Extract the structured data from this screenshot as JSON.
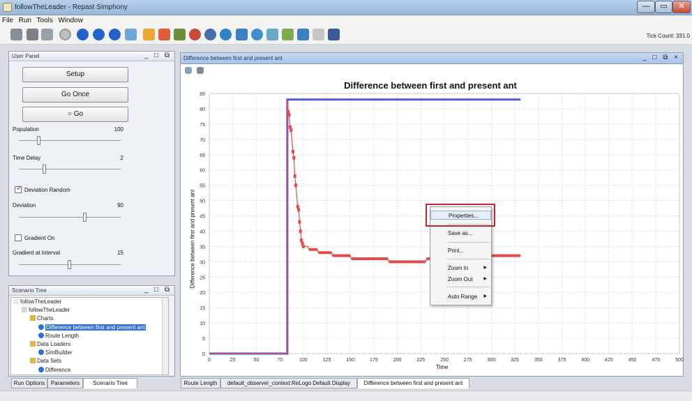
{
  "window": {
    "title": "followTheLeader - Repast Simphony",
    "controls": {
      "minimize": "—",
      "maximize": "▭",
      "close": "✕"
    }
  },
  "menu": [
    "File",
    "Run",
    "Tools",
    "Window"
  ],
  "toolbar": {
    "icons": [
      "save-icon",
      "disk-icon",
      "database-icon",
      "power-icon",
      "play-icon",
      "step-icon",
      "stop-icon",
      "reset-icon",
      "dock-icon",
      "line-chart-icon",
      "histogram-icon",
      "agents-icon",
      "gis-icon",
      "data-icon",
      "network-icon",
      "console-icon",
      "globe-icon",
      "users-icon",
      "image-icon",
      "grid-icon",
      "table-icon",
      "truck-icon"
    ],
    "tick_count": "Tick Count: 331.0"
  },
  "user_panel": {
    "title": "User Panel",
    "controls": "_ □ ⧉",
    "setup": "Setup",
    "go_once": "Go Once",
    "go": "○ Go",
    "population": {
      "label": "Population",
      "value": "100",
      "fraction": 0.2
    },
    "time_delay": {
      "label": "Time Delay",
      "value": "2",
      "fraction": 0.25
    },
    "deviation_random": {
      "label": "Deviation Random",
      "checked": true
    },
    "deviation": {
      "label": "Deviation",
      "value": "90",
      "fraction": 0.65
    },
    "gradient_on": {
      "label": "Gradient On",
      "checked": false
    },
    "gradient_interval": {
      "label": "Gradient at Interval",
      "value": "15",
      "fraction": 0.5
    }
  },
  "scenario_tree": {
    "title": "Scenario Tree",
    "controls": "_ □ ⧉",
    "nodes": [
      {
        "label": "followTheLeader",
        "icon": "project-icon",
        "depth": 0,
        "selected": false
      },
      {
        "label": "followTheLeader",
        "icon": "model-icon",
        "depth": 1,
        "selected": false
      },
      {
        "label": "Charts",
        "icon": "folder-icon",
        "depth": 2,
        "selected": false
      },
      {
        "label": "Difference between first and present ant",
        "icon": "chart-node-icon",
        "depth": 3,
        "selected": true
      },
      {
        "label": "Route Length",
        "icon": "chart-node-icon",
        "depth": 3,
        "selected": false
      },
      {
        "label": "Data Loaders",
        "icon": "folder-icon",
        "depth": 2,
        "selected": false
      },
      {
        "label": "SimBuilder",
        "icon": "loader-node-icon",
        "depth": 3,
        "selected": false
      },
      {
        "label": "Data Sets",
        "icon": "folder-icon",
        "depth": 2,
        "selected": false
      },
      {
        "label": "Difference",
        "icon": "dataset-node-icon",
        "depth": 3,
        "selected": false
      }
    ]
  },
  "left_tabs": [
    "Run Options",
    "Parameters",
    "Scenario Tree"
  ],
  "chart_panel": {
    "title": "Difference between first and present ant",
    "controls": "_ □ ⧉ ×"
  },
  "display_tabs": [
    "Route Length",
    "default_observer_context:ReLogo Default Display",
    "Difference between first and present ant"
  ],
  "context_menu": {
    "items": [
      {
        "label": "Properties...",
        "submenu": false
      },
      {
        "label": "Save as...",
        "submenu": false
      },
      {
        "label": "Print...",
        "submenu": false
      },
      {
        "label": "Zoom In",
        "submenu": true
      },
      {
        "label": "Zoom Out",
        "submenu": true
      },
      {
        "label": "Auto Range",
        "submenu": true
      }
    ]
  },
  "chart_data": {
    "type": "line",
    "title": "Difference between first and present ant",
    "xlabel": "Time",
    "ylabel": "Difference between first and present ant",
    "xlim": [
      0,
      500
    ],
    "ylim": [
      0,
      85
    ],
    "xticks": [
      0,
      25,
      50,
      75,
      100,
      125,
      150,
      175,
      200,
      225,
      250,
      275,
      300,
      325,
      350,
      375,
      400,
      425,
      450,
      475,
      500
    ],
    "yticks": [
      0,
      5,
      10,
      15,
      20,
      25,
      30,
      35,
      40,
      45,
      50,
      55,
      60,
      65,
      70,
      75,
      80,
      85
    ],
    "grid": true,
    "series": [
      {
        "color": "#4f55e0",
        "points": [
          [
            0,
            0
          ],
          [
            83,
            0
          ],
          [
            83,
            83
          ],
          [
            85,
            83
          ],
          [
            100,
            83
          ],
          [
            150,
            83
          ],
          [
            200,
            83
          ],
          [
            250,
            83
          ],
          [
            300,
            83
          ],
          [
            331,
            83
          ]
        ]
      },
      {
        "color": "#e84a4a",
        "points": [
          [
            0,
            0
          ],
          [
            83,
            0
          ],
          [
            83,
            83
          ],
          [
            84,
            79
          ],
          [
            85,
            78
          ],
          [
            86,
            74
          ],
          [
            87,
            73
          ],
          [
            89,
            66
          ],
          [
            90,
            64
          ],
          [
            91,
            58
          ],
          [
            92,
            55
          ],
          [
            94,
            48
          ],
          [
            95,
            47
          ],
          [
            96,
            43
          ],
          [
            97,
            40
          ],
          [
            98,
            37
          ],
          [
            99,
            36
          ],
          [
            100,
            35
          ],
          [
            105,
            35
          ],
          [
            106,
            34
          ],
          [
            115,
            34
          ],
          [
            116,
            33
          ],
          [
            130,
            33
          ],
          [
            131,
            32
          ],
          [
            150,
            32
          ],
          [
            151,
            31
          ],
          [
            190,
            31
          ],
          [
            191,
            30
          ],
          [
            230,
            30
          ],
          [
            231,
            31
          ],
          [
            250,
            31
          ],
          [
            251,
            30
          ],
          [
            260,
            30
          ],
          [
            261,
            32
          ],
          [
            300,
            32
          ],
          [
            331,
            32
          ]
        ]
      }
    ]
  }
}
